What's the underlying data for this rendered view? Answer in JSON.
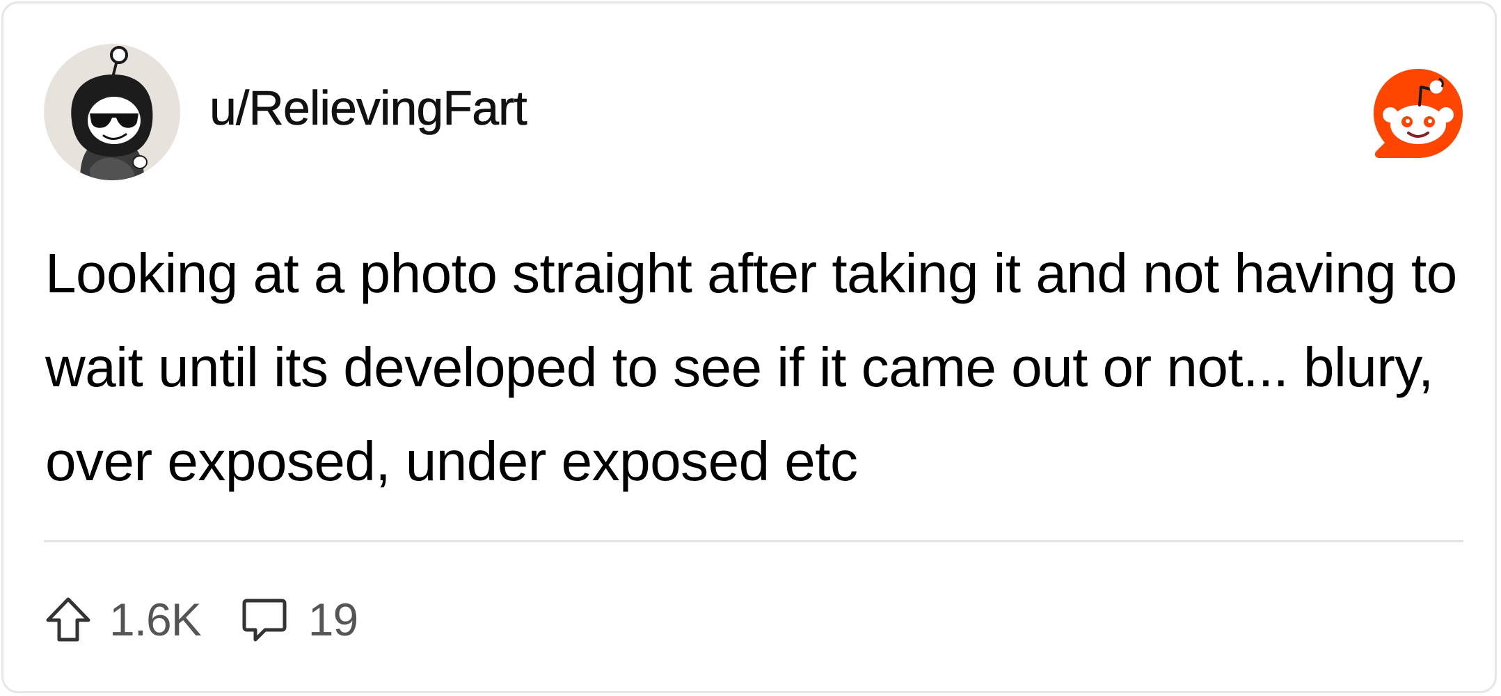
{
  "post": {
    "username": "u/RelievingFart",
    "body": "Looking at a photo straight after taking it and not having to wait until its developed to see if it came out or not... blury, over exposed, under exposed etc",
    "upvotes": "1.6K",
    "comments": "19"
  },
  "icons": {
    "avatar": "snoo-avatar-hooded-sunglasses",
    "brand": "reddit-logo-icon",
    "upvote": "arrow-up-icon",
    "comment": "speech-bubble-icon"
  },
  "colors": {
    "reddit_orange": "#FF4500",
    "text": "#000000",
    "muted_text": "#555555",
    "divider": "#E4E4E4",
    "avatar_bg": "#E8E2DC"
  }
}
